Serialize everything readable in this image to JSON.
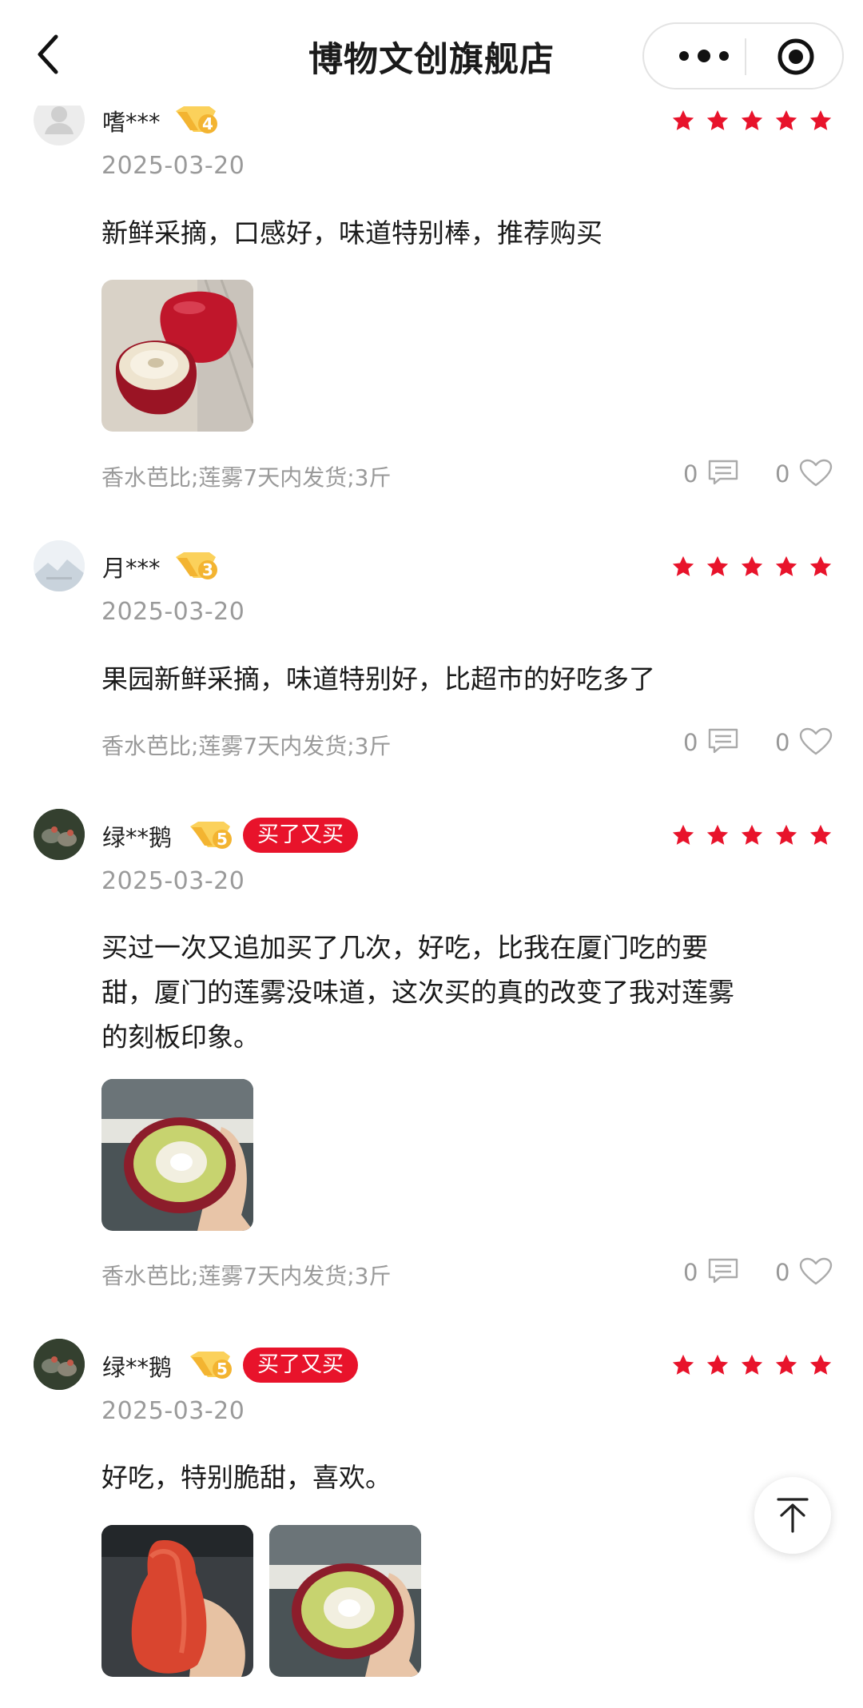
{
  "header": {
    "title": "博物文创旗舰店"
  },
  "colors": {
    "star": "#e8132b",
    "badge": "#f3b431",
    "accent": "#e8132b"
  },
  "reviews": [
    {
      "user": "嗜***",
      "level": "4",
      "buy_again": "",
      "date": "2025-03-20",
      "text": "新鲜采摘，口感好，味道特别棒，推荐购买",
      "spec": "香水芭比;莲雾7天内发货;3斤",
      "comments": "0",
      "likes": "0",
      "rating": 5
    },
    {
      "user": "月***",
      "level": "3",
      "buy_again": "",
      "date": "2025-03-20",
      "text": "果园新鲜采摘，味道特别好，比超市的好吃多了",
      "spec": "香水芭比;莲雾7天内发货;3斤",
      "comments": "0",
      "likes": "0",
      "rating": 5
    },
    {
      "user": "绿**鹅",
      "level": "5",
      "buy_again": "买了又买",
      "date": "2025-03-20",
      "text_lines": [
        "买过一次又追加买了几次，好吃，比我在厦门吃的要",
        "甜，厦门的莲雾没味道，这次买的真的改变了我对莲雾",
        "的刻板印象。"
      ],
      "spec": "香水芭比;莲雾7天内发货;3斤",
      "comments": "0",
      "likes": "0",
      "rating": 5
    },
    {
      "user": "绿**鹅",
      "level": "5",
      "buy_again": "买了又买",
      "date": "2025-03-20",
      "text": "好吃，特别脆甜，喜欢。",
      "rating": 5
    }
  ]
}
